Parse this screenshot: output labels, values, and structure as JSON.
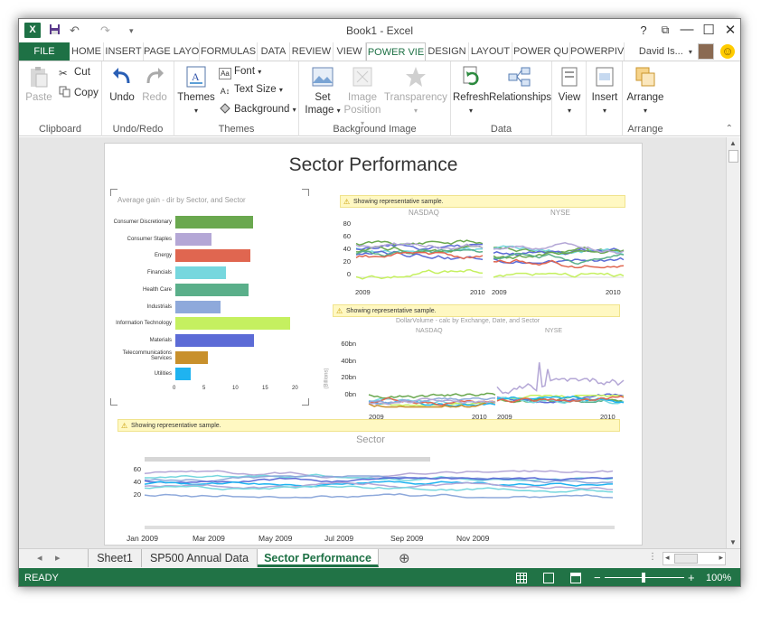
{
  "window": {
    "title": "Book1 - Excel",
    "help": "?",
    "restore": "⧉",
    "minimize": "—",
    "maximize": "☐",
    "close": "✕"
  },
  "quick_access": {
    "undo": "↶",
    "redo": "↷",
    "customize": "▾"
  },
  "tabs": [
    "FILE",
    "HOME",
    "INSERT",
    "PAGE LAYO",
    "FORMULAS",
    "DATA",
    "REVIEW",
    "VIEW",
    "POWER VIE",
    "DESIGN",
    "LAYOUT",
    "POWER QU",
    "POWERPIV"
  ],
  "user": {
    "name": "David Is...",
    "dropdown": "▾",
    "smiley": "☺"
  },
  "ribbon": {
    "clipboard": {
      "paste": "Paste",
      "cut": "Cut",
      "copy": "Copy",
      "label": "Clipboard"
    },
    "undo_redo": {
      "undo": "Undo",
      "redo": "Redo",
      "label": "Undo/Redo"
    },
    "themes": {
      "themes": "Themes",
      "font": "Font",
      "text_size": "Text Size",
      "background": "Background",
      "label": "Themes"
    },
    "background_image": {
      "set_image": "Set Image",
      "image_position": "Image Position",
      "transparency": "Transparency",
      "label": "Background Image"
    },
    "data": {
      "refresh": "Refresh",
      "relationships": "Relationships",
      "label": "Data"
    },
    "view": {
      "view": "View"
    },
    "insert": {
      "insert": "Insert"
    },
    "arrange": {
      "arrange": "Arrange",
      "label": "Arrange"
    }
  },
  "report": {
    "title": "Sector Performance",
    "bar_chart": {
      "caption": "Average gain - dir by Sector, and Sector",
      "categories": [
        "Consumer Discretionary",
        "Consumer Staples",
        "Energy",
        "Financials",
        "Health Care",
        "Industrials",
        "Information Technology",
        "Materials",
        "Telecommunications Services",
        "Utilities"
      ],
      "values": [
        13,
        6,
        12.5,
        8.5,
        12.2,
        7.5,
        19.3,
        13.2,
        5.5,
        2.5
      ],
      "colors": [
        "#6aa84f",
        "#b4a7d6",
        "#e06650",
        "#76d7de",
        "#5aaf8a",
        "#8ea9db",
        "#c5f060",
        "#5c6bd6",
        "#c8902c",
        "#1fb3f0"
      ],
      "xticks": [
        "0",
        "5",
        "10",
        "15",
        "20"
      ],
      "xmax": 20
    },
    "sample_note": "Showing representative sample.",
    "gain_panels": {
      "left_title": "NASDAQ",
      "right_title": "NYSE",
      "yticks": [
        "80",
        "60",
        "40",
        "20",
        "0"
      ],
      "xstart": "2009",
      "xend": "2010"
    },
    "volume_panels": {
      "caption": "DollarVolume - calc by Exchange, Date, and Sector",
      "left_title": "NASDAQ",
      "right_title": "NYSE",
      "yticks": [
        "60bn",
        "40bn",
        "20bn",
        "0bn"
      ],
      "ylabel": "(Billions)",
      "xstart": "2009",
      "xend": "2010"
    },
    "sector_chart": {
      "title": "Sector",
      "yticks": [
        "60",
        "40",
        "20"
      ],
      "xticks": [
        "Jan 2009",
        "Mar 2009",
        "May 2009",
        "Jul 2009",
        "Sep 2009",
        "Nov 2009"
      ]
    }
  },
  "sheets": [
    "Sheet1",
    "SP500 Annual Data",
    "Sector Performance"
  ],
  "sheet_nav": {
    "prev": "◂",
    "next": "▸",
    "add": "⊕"
  },
  "status": {
    "ready": "READY",
    "zoom": "100%",
    "zoom_out": "−",
    "zoom_in": "+"
  },
  "colors": {
    "excel_green": "#217346",
    "accent": "#1e7145"
  }
}
